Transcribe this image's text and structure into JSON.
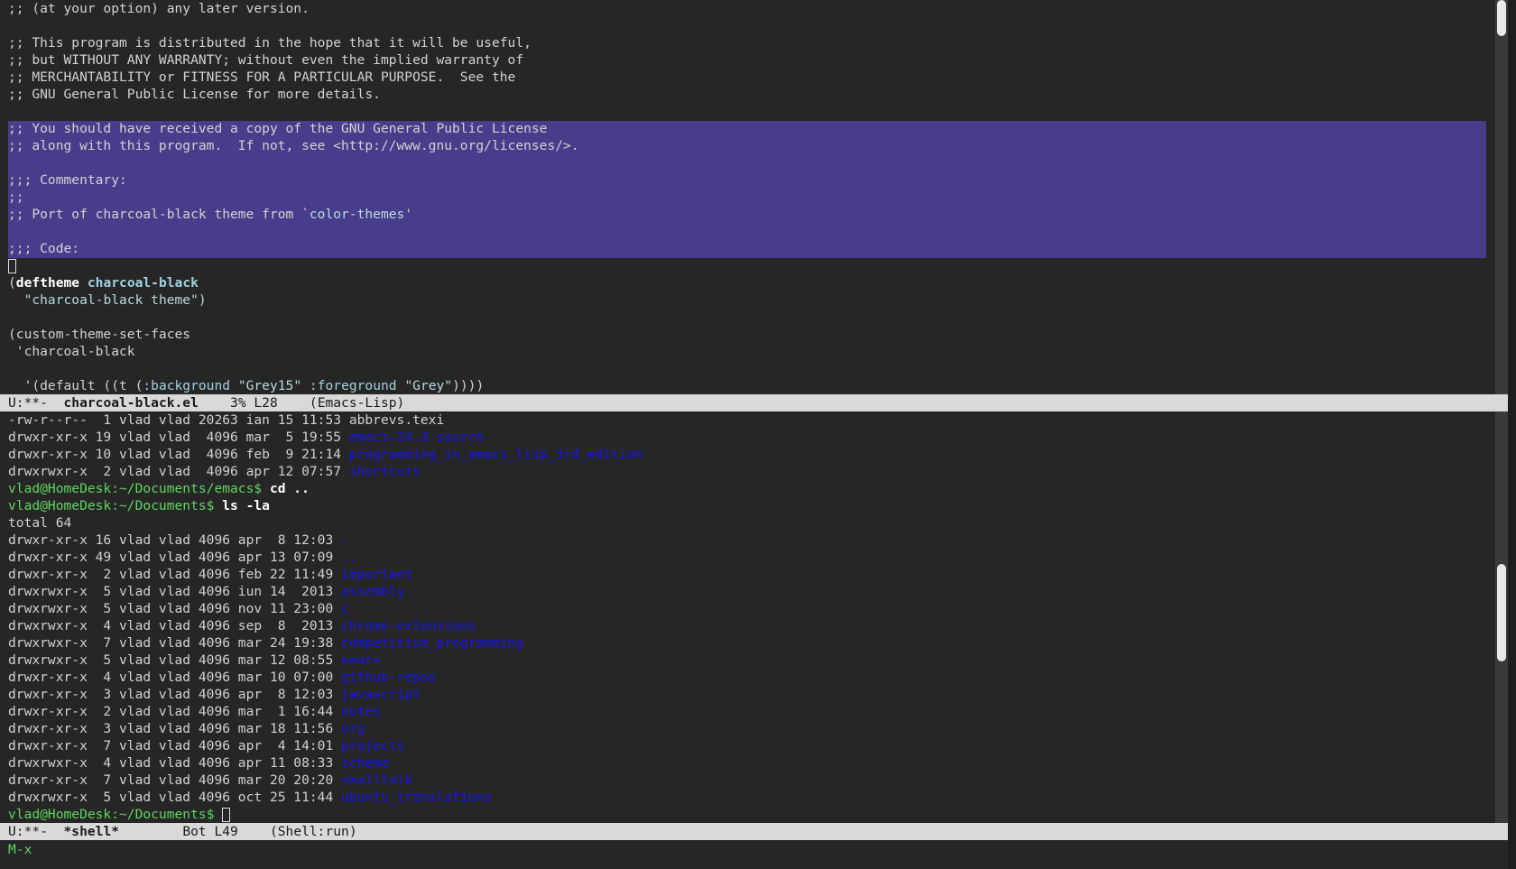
{
  "editor": {
    "lines": [
      ";; (at your option) any later version.",
      "",
      ";; This program is distributed in the hope that it will be useful,",
      ";; but WITHOUT ANY WARRANTY; without even the implied warranty of",
      ";; MERCHANTABILITY or FITNESS FOR A PARTICULAR PURPOSE.  See the",
      ";; GNU General Public License for more details.",
      "",
      ";; You should have received a copy of the GNU General Public License",
      ";; along with this program.  If not, see <http://www.gnu.org/licenses/>.",
      "",
      ";;; Commentary:",
      ";;",
      ";; Port of charcoal-black theme from `",
      ";;; Code:"
    ],
    "commentary_quote": "color-themes",
    "commentary_end": "'",
    "deftheme_kw": "deftheme",
    "theme_name": "charcoal-black",
    "theme_doc": "\"charcoal-black theme\")",
    "set_faces": "(custom-theme-set-faces",
    "theme_quote": " 'charcoal-black",
    "default_open": "  '(default ((t (",
    "background_key": ":background",
    "background_val": "\"Grey15\"",
    "foreground_key": ":foreground",
    "foreground_val": "\"Grey\"",
    "default_close": "))))"
  },
  "modeline_top": {
    "status": "U:**-  ",
    "buffer": "charcoal-black.el",
    "position": "    3% L28    ",
    "mode": "(Emacs-Lisp)"
  },
  "shell": {
    "pre_lines": [
      {
        "perm": "-rw-r--r--  1 vlad vlad 20263 ian 15 11:53 ",
        "name": "abbrevs.texi",
        "isdir": false
      },
      {
        "perm": "drwxr-xr-x 19 vlad vlad  4096 mar  5 19:55 ",
        "name": "emacs-24.3-source",
        "isdir": true
      },
      {
        "perm": "drwxr-xr-x 10 vlad vlad  4096 feb  9 21:14 ",
        "name": "programming_in_emacs_lisp_3rd_edition",
        "isdir": true
      },
      {
        "perm": "drwxrwxr-x  2 vlad vlad  4096 apr 12 07:57 ",
        "name": "shortcuts",
        "isdir": true
      }
    ],
    "prompt_emacs": "vlad@HomeDesk:~/Documents/emacs$ ",
    "cmd_cd": "cd ..",
    "prompt_docs": "vlad@HomeDesk:~/Documents$ ",
    "cmd_ls": "ls -la",
    "total": "total 64",
    "entries": [
      {
        "perm": "drwxr-xr-x 16 vlad vlad 4096 apr  8 12:03 ",
        "name": "."
      },
      {
        "perm": "drwxr-xr-x 49 vlad vlad 4096 apr 13 07:09 ",
        "name": ".."
      },
      {
        "perm": "drwxr-xr-x  2 vlad vlad 4096 feb 22 11:49 ",
        "name": "important"
      },
      {
        "perm": "drwxrwxr-x  5 vlad vlad 4096 iun 14  2013 ",
        "name": "assembly"
      },
      {
        "perm": "drwxrwxr-x  5 vlad vlad 4096 nov 11 23:00 ",
        "name": "c"
      },
      {
        "perm": "drwxrwxr-x  4 vlad vlad 4096 sep  8  2013 ",
        "name": "chrome-extensions"
      },
      {
        "perm": "drwxrwxr-x  7 vlad vlad 4096 mar 24 19:38 ",
        "name": "competitive_programming"
      },
      {
        "perm": "drwxrwxr-x  5 vlad vlad 4096 mar 12 08:55 ",
        "name": "emacs"
      },
      {
        "perm": "drwxr-xr-x  4 vlad vlad 4096 mar 10 07:00 ",
        "name": "github-repos"
      },
      {
        "perm": "drwxr-xr-x  3 vlad vlad 4096 apr  8 12:03 ",
        "name": "javascript"
      },
      {
        "perm": "drwxr-xr-x  2 vlad vlad 4096 mar  1 16:44 ",
        "name": "notes"
      },
      {
        "perm": "drwxr-xr-x  3 vlad vlad 4096 mar 18 11:56 ",
        "name": "org"
      },
      {
        "perm": "drwxr-xr-x  7 vlad vlad 4096 apr  4 14:01 ",
        "name": "projects"
      },
      {
        "perm": "drwxrwxr-x  4 vlad vlad 4096 apr 11 08:33 ",
        "name": "scheme"
      },
      {
        "perm": "drwxr-xr-x  7 vlad vlad 4096 mar 20 20:20 ",
        "name": "smalltalk"
      },
      {
        "perm": "drwxrwxr-x  5 vlad vlad 4096 oct 25 11:44 ",
        "name": "ubuntu_translations"
      }
    ]
  },
  "modeline_bottom": {
    "status": "U:**-  ",
    "buffer": "*shell*",
    "position": "        Bot L49    ",
    "mode": "(Shell:run)"
  },
  "minibuffer": "M-x"
}
